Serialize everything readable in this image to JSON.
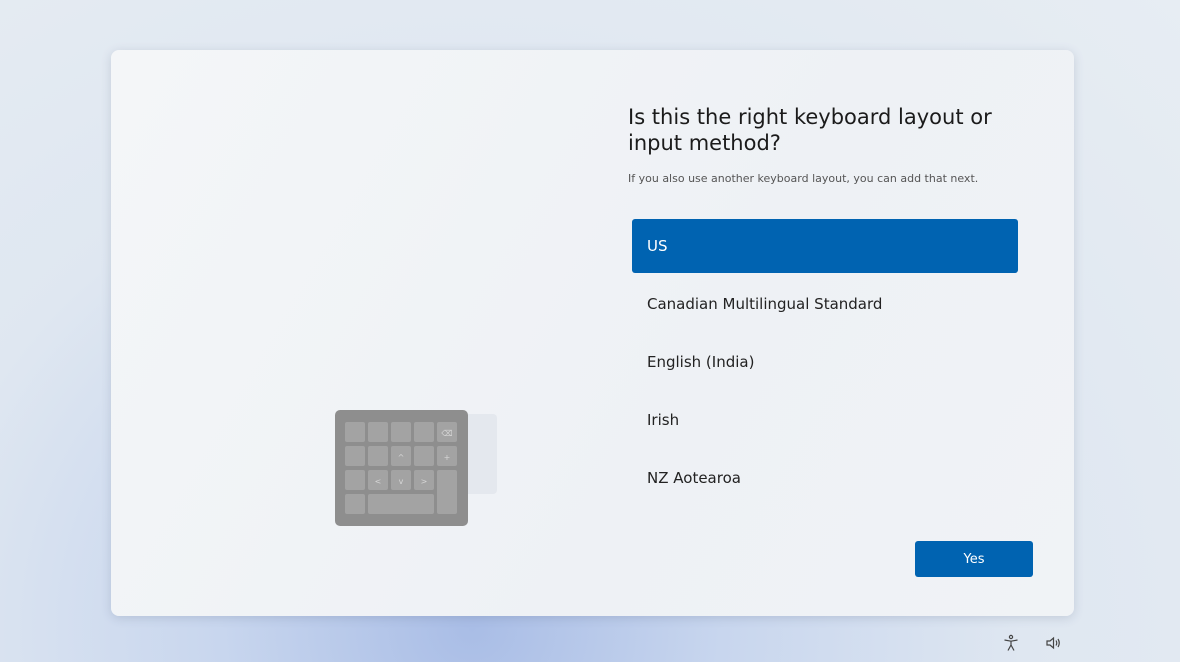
{
  "dialog": {
    "title": "Is this the right keyboard layout or input method?",
    "subtitle": "If you also use another keyboard layout, you can add that next.",
    "layouts": [
      {
        "label": "US",
        "selected": true
      },
      {
        "label": "Canadian Multilingual Standard",
        "selected": false
      },
      {
        "label": "English (India)",
        "selected": false
      },
      {
        "label": "Irish",
        "selected": false
      },
      {
        "label": "NZ Aotearoa",
        "selected": false
      }
    ],
    "yes_label": "Yes"
  },
  "footer": {
    "icons": [
      "accessibility-icon",
      "volume-icon"
    ]
  },
  "colors": {
    "accent": "#0063b1",
    "card": "#f2f4f7"
  }
}
